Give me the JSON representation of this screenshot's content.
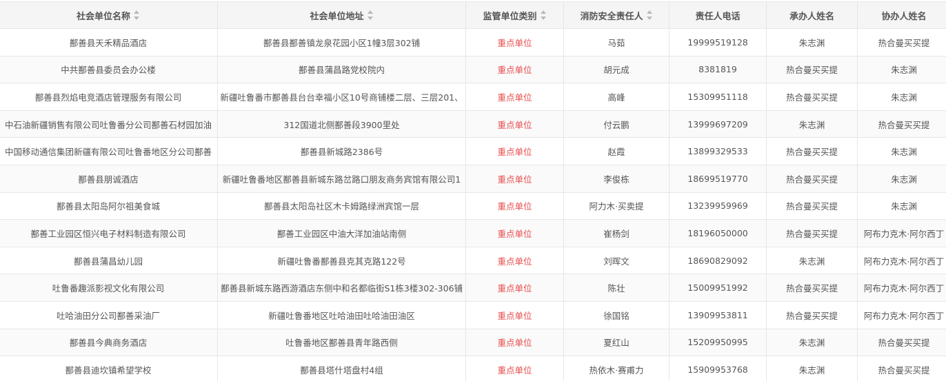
{
  "table": {
    "headers": {
      "name": "社会单位名称",
      "address": "社会单位地址",
      "type": "监管单位类别",
      "contact": "消防安全责任人",
      "phone": "责任人电话",
      "handler": "承办人姓名",
      "assistant": "协办人姓名"
    },
    "rows": [
      {
        "name": "鄯善县天禾精品酒店",
        "address": "鄯善县鄯善镇龙泉花园小区1幢3层302铺",
        "type": "重点单位",
        "contact": "马茹",
        "phone": "19999519128",
        "handler": "朱志渊",
        "assistant": "热合曼买买提"
      },
      {
        "name": "中共鄯善县委员会办公楼",
        "address": "鄯善县蒲昌路党校院内",
        "type": "重点单位",
        "contact": "胡元成",
        "phone": "8381819",
        "handler": "热合曼买买提",
        "assistant": "朱志渊"
      },
      {
        "name": "鄯善县烈焰电竞酒店管理服务有限公司",
        "address": "新疆吐鲁番市鄯善县台台幸福小区10号商铺楼二层、三层201、",
        "type": "重点单位",
        "contact": "高峰",
        "phone": "15309951118",
        "handler": "热合曼买买提",
        "assistant": "朱志渊"
      },
      {
        "name": "中石油新疆销售有限公司吐鲁番分公司鄯善石材园加油",
        "address": "312国道北侧鄯善段3900里处",
        "type": "重点单位",
        "contact": "付云鹏",
        "phone": "13999697209",
        "handler": "朱志渊",
        "assistant": "热合曼买买提"
      },
      {
        "name": "中国移动通信集团新疆有限公司吐鲁番地区分公司鄯善",
        "address": "鄯善县新城路2386号",
        "type": "重点单位",
        "contact": "赵霞",
        "phone": "13899329533",
        "handler": "热合曼买买提",
        "assistant": "朱志渊"
      },
      {
        "name": "鄯善县朋诚酒店",
        "address": "新疆吐鲁番地区鄯善县新城东路岔路口朋友商务宾馆有限公司1",
        "type": "重点单位",
        "contact": "李俊栋",
        "phone": "18699519770",
        "handler": "热合曼买买提",
        "assistant": "朱志渊"
      },
      {
        "name": "鄯善县太阳岛阿尔祖美食城",
        "address": "鄯善县太阳岛社区木卡姆路绿洲宾馆一层",
        "type": "重点单位",
        "contact": "阿力木·买卖提",
        "phone": "13239959969",
        "handler": "热合曼买买提",
        "assistant": "朱志渊"
      },
      {
        "name": "鄯善工业园区恒兴电子材料制造有限公司",
        "address": "鄯善工业园区中油大洋加油站南侧",
        "type": "重点单位",
        "contact": "崔杨剑",
        "phone": "18196050000",
        "handler": "热合曼买买提",
        "assistant": "阿布力克木·阿尔西丁"
      },
      {
        "name": "鄯善县蒲昌幼儿园",
        "address": "新疆吐鲁番鄯善县克其克路122号",
        "type": "重点单位",
        "contact": "刘晖文",
        "phone": "18690829092",
        "handler": "朱志渊",
        "assistant": "阿布力克木·阿尔西丁"
      },
      {
        "name": "吐鲁番趣派影视文化有限公司",
        "address": "鄯善县新城东路西游酒店东侧中和名都临街S1栋3楼302-306铺",
        "type": "重点单位",
        "contact": "陈壮",
        "phone": "15009951992",
        "handler": "热合曼买买提",
        "assistant": "阿布力克木·阿尔西丁"
      },
      {
        "name": "吐哈油田分公司鄯善采油厂",
        "address": "新疆吐鲁番地区吐哈油田吐哈油田油区",
        "type": "重点单位",
        "contact": "徐国铭",
        "phone": "13909953811",
        "handler": "热合曼买买提",
        "assistant": "阿布力克木·阿尔西丁"
      },
      {
        "name": "鄯善县今典商务酒店",
        "address": "吐鲁番地区鄯善县青年路西侧",
        "type": "重点单位",
        "contact": "夏红山",
        "phone": "15209950995",
        "handler": "朱志渊",
        "assistant": "热合曼买买提"
      },
      {
        "name": "鄯善县迪坎镇希望学校",
        "address": "鄯善县塔什塔盘村4组",
        "type": "重点单位",
        "contact": "热依木·赛甫力",
        "phone": "15909953768",
        "handler": "朱志渊",
        "assistant": "热合曼买买提"
      }
    ]
  }
}
